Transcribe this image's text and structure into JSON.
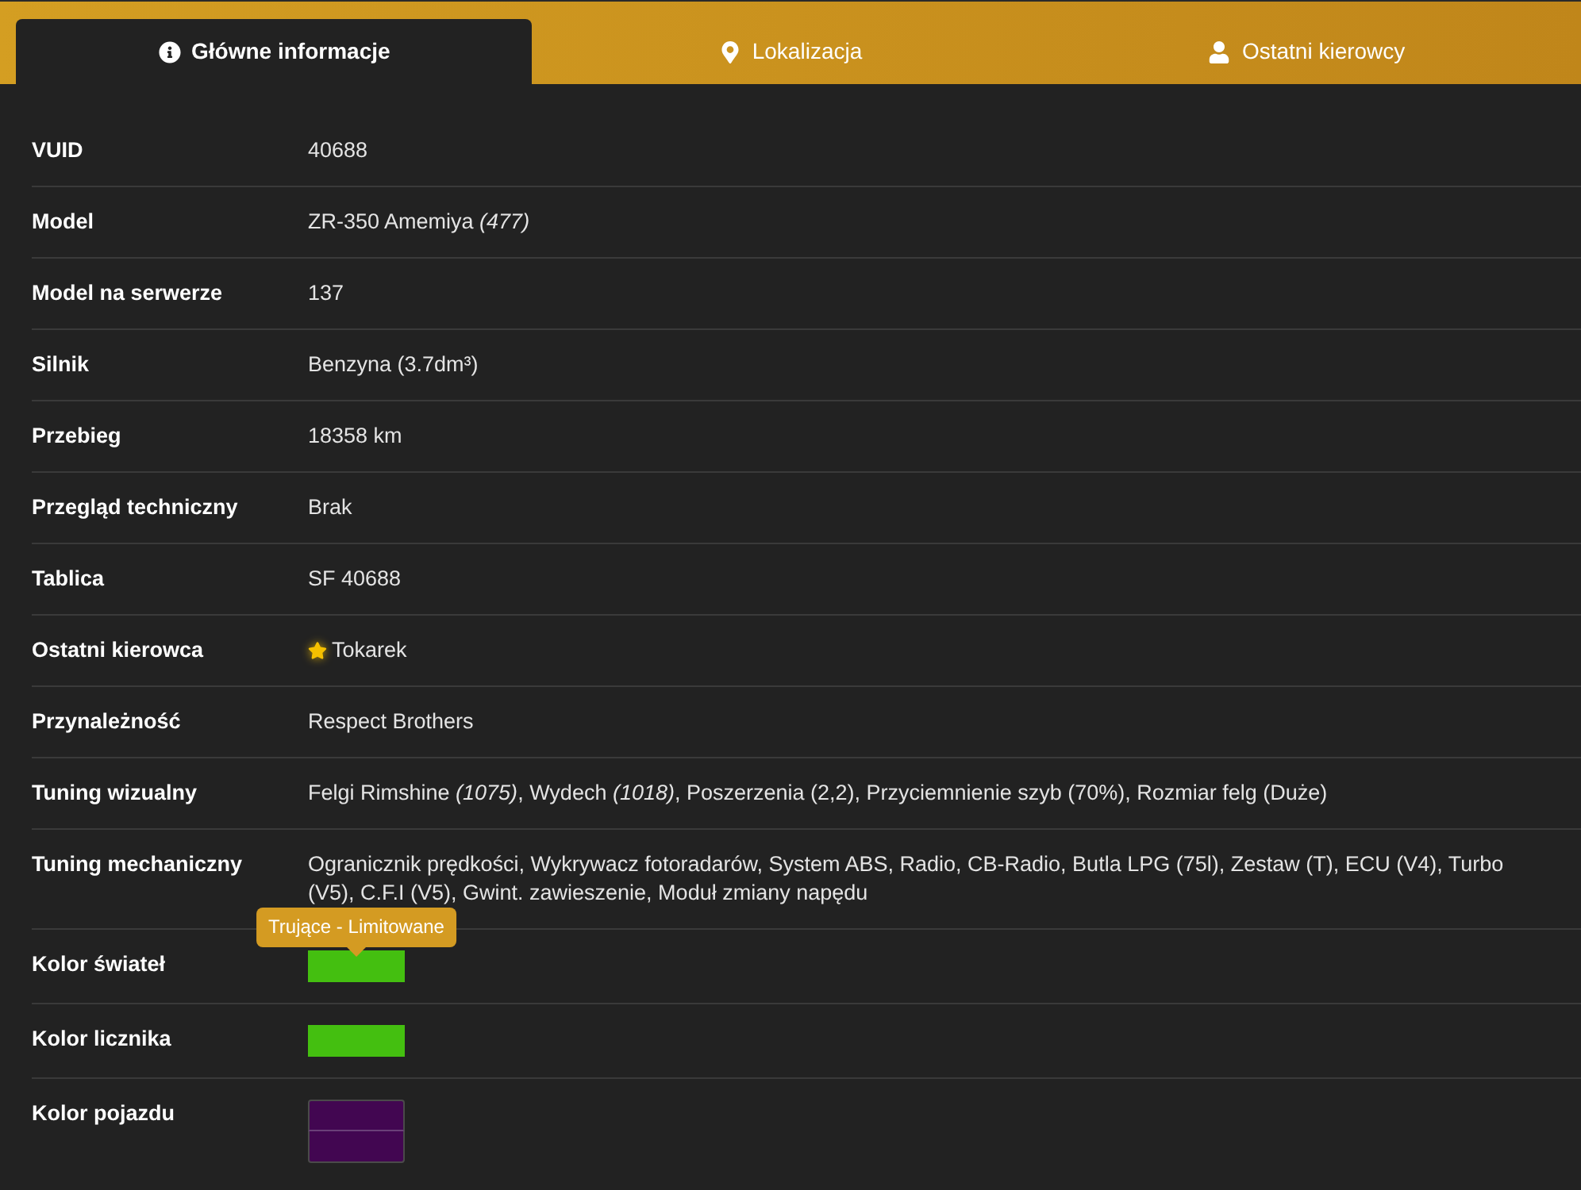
{
  "tabs": [
    {
      "label": "Główne informacje",
      "selected": true
    },
    {
      "label": "Lokalizacja",
      "selected": false
    },
    {
      "label": "Ostatni kierowcy",
      "selected": false
    }
  ],
  "rows": [
    {
      "kind": "text",
      "label": "VUID",
      "value": "40688"
    },
    {
      "kind": "text",
      "label": "Model",
      "value": "ZR-350 Amemiya *(477)*"
    },
    {
      "kind": "text",
      "label": "Model na serwerze",
      "value": "137"
    },
    {
      "kind": "text",
      "label": "Silnik",
      "value": "Benzyna (3.7dm³)"
    },
    {
      "kind": "text",
      "label": "Przebieg",
      "value": "18358 km"
    },
    {
      "kind": "text",
      "label": "Przegląd techniczny",
      "value": "Brak"
    },
    {
      "kind": "text",
      "label": "Tablica",
      "value": "SF 40688"
    },
    {
      "kind": "starred",
      "label": "Ostatni kierowca",
      "value": "Tokarek"
    },
    {
      "kind": "text",
      "label": "Przynależność",
      "value": "Respect Brothers"
    },
    {
      "kind": "text",
      "label": "Tuning wizualny",
      "value": "Felgi Rimshine *(1075)*, Wydech *(1018)*, Poszerzenia (2,2), Przyciemnienie szyb (70%), Rozmiar felg (Duże)"
    },
    {
      "kind": "text",
      "label": "Tuning mechaniczny",
      "value": "Ogranicznik prędkości, Wykrywacz fotoradarów, System ABS, Radio, CB-Radio, Butla LPG (75l), Zestaw (T), ECU (V4), Turbo (V5), C.F.I (V5), Gwint. zawieszenie, Moduł zmiany napędu"
    },
    {
      "kind": "swatch",
      "label": "Kolor świateł",
      "tooltip": "Trujące - Limitowane",
      "swatches": [
        {
          "color": "#44bf10"
        }
      ]
    },
    {
      "kind": "swatch",
      "label": "Kolor licznika",
      "swatches": [
        {
          "color": "#44bf10"
        }
      ]
    },
    {
      "kind": "swatch",
      "label": "Kolor pojazdu",
      "swatches": [
        {
          "color": "#420651"
        },
        {
          "color": "#420651"
        }
      ]
    }
  ]
}
